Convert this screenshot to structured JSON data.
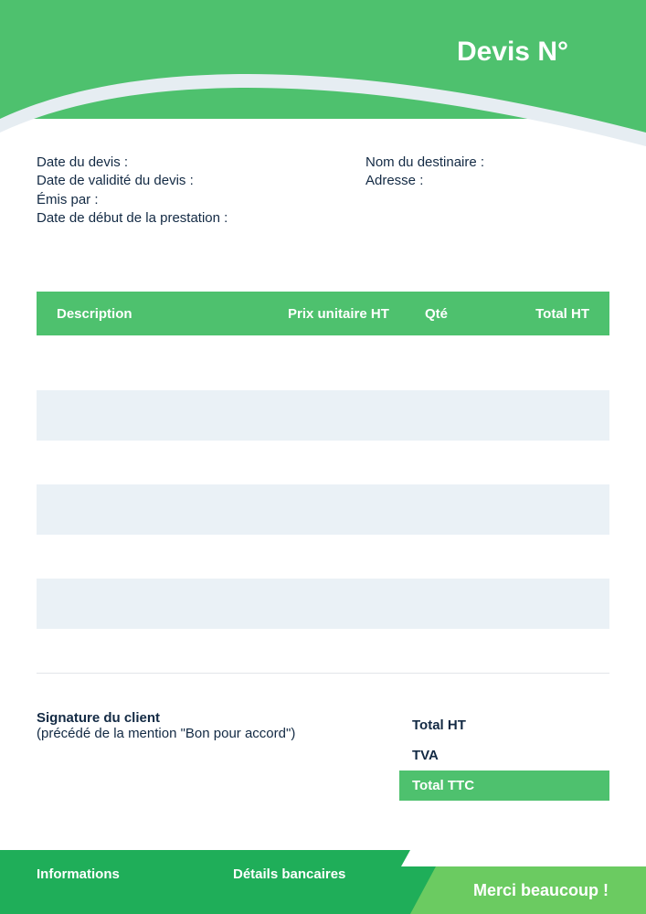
{
  "title": "Devis N°",
  "meta": {
    "date_label": "Date du devis :",
    "validity_label": "Date de validité du devis :",
    "issuer_label": "Émis par :",
    "start_label": "Date de début de la prestation :",
    "recipient_label": "Nom du destinaire :",
    "address_label": "Adresse :"
  },
  "table": {
    "headers": {
      "description": "Description",
      "unit_price": "Prix unitaire HT",
      "qty": "Qté",
      "total": "Total HT"
    }
  },
  "signature": {
    "title": "Signature du client",
    "note": "(précédé de la mention \"Bon pour accord\")"
  },
  "totals": {
    "ht": "Total HT",
    "tva": "TVA",
    "ttc": "Total TTC"
  },
  "footer": {
    "info": "Informations",
    "bank": "Détails bancaires",
    "thanks": "Merci beaucoup !"
  },
  "colors": {
    "primary": "#4ec16e",
    "dark_green": "#1fae59",
    "light_green": "#6bcb61",
    "text": "#132a44",
    "band": "#eaf1f6"
  }
}
